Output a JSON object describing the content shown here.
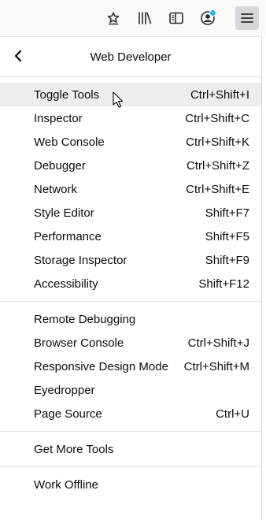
{
  "toolbar": {
    "icons": [
      "star-page-icon",
      "library-icon",
      "sidebar-icon",
      "account-icon",
      "menu-icon"
    ],
    "colors": {
      "bg": "#f9f9fa",
      "active": "#d7d7db",
      "badge": "#2bb4f0"
    }
  },
  "panel": {
    "title": "Web Developer"
  },
  "groups": [
    [
      {
        "label": "Toggle Tools",
        "shortcut": "Ctrl+Shift+I"
      },
      {
        "label": "Inspector",
        "shortcut": "Ctrl+Shift+C"
      },
      {
        "label": "Web Console",
        "shortcut": "Ctrl+Shift+K"
      },
      {
        "label": "Debugger",
        "shortcut": "Ctrl+Shift+Z"
      },
      {
        "label": "Network",
        "shortcut": "Ctrl+Shift+E"
      },
      {
        "label": "Style Editor",
        "shortcut": "Shift+F7"
      },
      {
        "label": "Performance",
        "shortcut": "Shift+F5"
      },
      {
        "label": "Storage Inspector",
        "shortcut": "Shift+F9"
      },
      {
        "label": "Accessibility",
        "shortcut": "Shift+F12"
      }
    ],
    [
      {
        "label": "Remote Debugging",
        "shortcut": ""
      },
      {
        "label": "Browser Console",
        "shortcut": "Ctrl+Shift+J"
      },
      {
        "label": "Responsive Design Mode",
        "shortcut": "Ctrl+Shift+M"
      },
      {
        "label": "Eyedropper",
        "shortcut": ""
      },
      {
        "label": "Page Source",
        "shortcut": "Ctrl+U"
      }
    ],
    [
      {
        "label": "Get More Tools",
        "shortcut": ""
      }
    ],
    [
      {
        "label": "Work Offline",
        "shortcut": ""
      }
    ]
  ]
}
